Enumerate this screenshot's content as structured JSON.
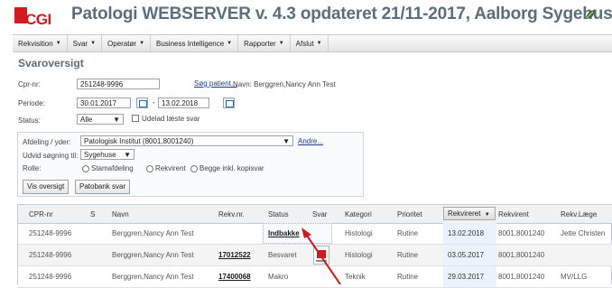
{
  "header": {
    "logo_text": "CGI",
    "title": "Patologi WEBSERVER v. 4.3 opdateret 21/11-2017, Aalborg Sygehus",
    "leaf_icon": "leaf-icon",
    "brand_color": "#d41a1f"
  },
  "menu": [
    {
      "label": "Rekvisition"
    },
    {
      "label": "Svar"
    },
    {
      "label": "Operatør"
    },
    {
      "label": "Business Intelligence"
    },
    {
      "label": "Rapporter"
    },
    {
      "label": "Afslut"
    }
  ],
  "form": {
    "page_title": "Svaroversigt",
    "cpr_label": "Cpr-nr:",
    "cpr_value": "251248-9996",
    "search_patient_link": "Søg patient...",
    "name_text": "Navn: Berggren,Nancy Ann Test",
    "period_label": "Periode:",
    "period_from": "30.01.2017",
    "period_sep": "-",
    "period_to": "13.02.2018",
    "status_label": "Status:",
    "status_value": "Alle",
    "exclude_read_label": "Udelad læste svar",
    "afdeling_label": "Afdeling / yder:",
    "afdeling_value": "Patologisk Institut (8001,8001240)",
    "andre_link": "Andre...",
    "udvid_label": "Udvid søgning til:",
    "udvid_value": "Sygehuse",
    "rolle_label": "Rolle:",
    "role_options": [
      "Stamafdeling",
      "Rekvirent",
      "Begge inkl. kopisvar"
    ],
    "vis_button": "Vis oversigt",
    "patobank_button": "Patobank svar"
  },
  "table": {
    "columns": [
      "CPR-nr",
      "S",
      "Navn",
      "Rekv.nr.",
      "Status",
      "Svar",
      "Kategori",
      "Prioritet",
      "Rekvireret",
      "Rekvirent",
      "Rekv.Læge"
    ],
    "sorted_indicator": "▼",
    "rows": [
      {
        "cpr": "251248-9996",
        "s": "",
        "name": "Berggren,Nancy Ann Test",
        "rekvnr": "",
        "status": "Indbakke",
        "kategori": "Histologi",
        "prioritet": "Rutine",
        "rekvireret": "13.02.2018",
        "rekvirent": "8001,8001240",
        "laege": "Jette Christen"
      },
      {
        "cpr": "251248-9996",
        "s": "",
        "name": "Berggren,Nancy Ann Test",
        "rekvnr": "17012522",
        "status": "Besvaret",
        "kategori": "Histologi",
        "prioritet": "Rutine",
        "rekvireret": "03.05.2017",
        "rekvirent": "8001,8001240",
        "laege": ""
      },
      {
        "cpr": "251248-9996",
        "s": "",
        "name": "Berggren,Nancy Ann Test",
        "rekvnr": "17400068",
        "status": "Makro",
        "kategori": "Teknik",
        "prioritet": "Rutine",
        "rekvireret": "29.03.2017",
        "rekvirent": "8001,8001240",
        "laege": "MV/LLG"
      }
    ]
  }
}
